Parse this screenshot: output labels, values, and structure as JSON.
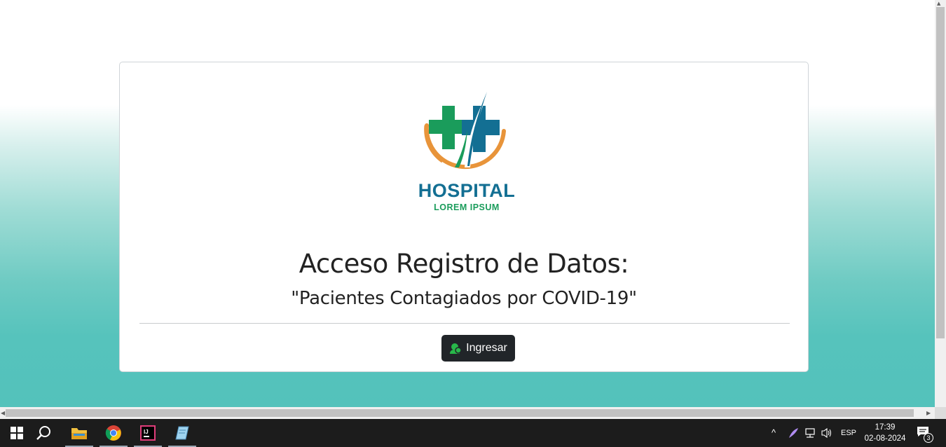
{
  "page": {
    "logo": {
      "word": "HOSPITAL",
      "sub": "LOREM IPSUM"
    },
    "title": "Acceso Registro de Datos:",
    "subtitle": "\"Pacientes Contagiados por COVID-19\"",
    "button": {
      "label": "Ingresar",
      "icon": "user-circle-icon"
    }
  },
  "colors": {
    "gradient_top": "#ffffff",
    "gradient_bottom": "#53c2bb",
    "button_bg": "#212529",
    "logo_green": "#1a9c5b",
    "logo_blue": "#136f93",
    "logo_orange": "#e8943a"
  },
  "taskbar": {
    "apps": [
      "windows-start-icon",
      "search-icon",
      "file-explorer-icon",
      "chrome-icon",
      "intellij-icon",
      "notepad-icon"
    ],
    "language": "ESP",
    "time": "17:39",
    "date": "02-08-2024",
    "notifications": "3"
  }
}
